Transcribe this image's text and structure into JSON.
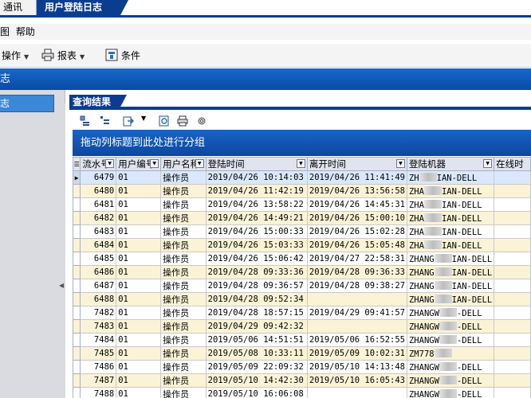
{
  "tabs": {
    "prev_label": "通讯",
    "active_label": "用户登陆日志"
  },
  "menu": {
    "items": [
      "图",
      "帮助"
    ]
  },
  "toolbar": {
    "operate_label": "操作",
    "report_label": "报表",
    "condition_label": "条件"
  },
  "title_band": {
    "text": "志"
  },
  "nav": {
    "item_label": "志"
  },
  "result": {
    "tab_label": "查询结果",
    "group_hint": "拖动列标题到此处进行分组"
  },
  "grid": {
    "columns": [
      "流水号",
      "用户编号",
      "用户名称",
      "登陆时间",
      "离开时间",
      "登陆机器",
      "在线时"
    ],
    "rows": [
      {
        "id": "6479",
        "user_no": "01",
        "user_name": "操作员",
        "login": "2019/04/26 10:14:03",
        "logout": "2019/04/26 11:41:49",
        "machine_a": "ZH",
        "machine_b": "IAN-DELL"
      },
      {
        "id": "6480",
        "user_no": "01",
        "user_name": "操作员",
        "login": "2019/04/26 11:42:19",
        "logout": "2019/04/26 13:56:58",
        "machine_a": "ZHA",
        "machine_b": "IAN-DELL"
      },
      {
        "id": "6481",
        "user_no": "01",
        "user_name": "操作员",
        "login": "2019/04/26 13:58:22",
        "logout": "2019/04/26 14:45:31",
        "machine_a": "ZHA",
        "machine_b": "IAN-DELL"
      },
      {
        "id": "6482",
        "user_no": "01",
        "user_name": "操作员",
        "login": "2019/04/26 14:49:21",
        "logout": "2019/04/26 15:00:10",
        "machine_a": "ZHA",
        "machine_b": "IAN-DELL"
      },
      {
        "id": "6483",
        "user_no": "01",
        "user_name": "操作员",
        "login": "2019/04/26 15:00:33",
        "logout": "2019/04/26 15:02:28",
        "machine_a": "ZHA",
        "machine_b": "IAN-DELL"
      },
      {
        "id": "6484",
        "user_no": "01",
        "user_name": "操作员",
        "login": "2019/04/26 15:03:33",
        "logout": "2019/04/26 15:05:48",
        "machine_a": "ZHA",
        "machine_b": "IAN-DELL"
      },
      {
        "id": "6485",
        "user_no": "01",
        "user_name": "操作员",
        "login": "2019/04/26 15:06:42",
        "logout": "2019/04/27 22:58:31",
        "machine_a": "ZHANG",
        "machine_b": "IAN-DELL"
      },
      {
        "id": "6486",
        "user_no": "01",
        "user_name": "操作员",
        "login": "2019/04/28 09:33:36",
        "logout": "2019/04/28 09:36:33",
        "machine_a": "ZHANG",
        "machine_b": "IAN-DELL"
      },
      {
        "id": "6487",
        "user_no": "01",
        "user_name": "操作员",
        "login": "2019/04/28 09:36:57",
        "logout": "2019/04/28 09:38:27",
        "machine_a": "ZHANG",
        "machine_b": "IAN-DELL"
      },
      {
        "id": "6488",
        "user_no": "01",
        "user_name": "操作员",
        "login": "2019/04/28 09:52:34",
        "logout": "",
        "machine_a": "ZHANG",
        "machine_b": "IAN-DELL"
      },
      {
        "id": "7482",
        "user_no": "01",
        "user_name": "操作员",
        "login": "2019/04/28 18:57:15",
        "logout": "2019/04/29 09:41:57",
        "machine_a": "ZHANGW",
        "machine_b": "-DELL"
      },
      {
        "id": "7483",
        "user_no": "01",
        "user_name": "操作员",
        "login": "2019/04/29 09:42:32",
        "logout": "",
        "machine_a": "ZHANGW",
        "machine_b": "-DELL"
      },
      {
        "id": "7484",
        "user_no": "01",
        "user_name": "操作员",
        "login": "2019/05/06 14:51:51",
        "logout": "2019/05/06 16:52:55",
        "machine_a": "ZHANGW",
        "machine_b": "-DELL"
      },
      {
        "id": "7485",
        "user_no": "01",
        "user_name": "操作员",
        "login": "2019/05/08 10:33:11",
        "logout": "2019/05/09 10:02:31",
        "machine_a": "ZM778",
        "machine_b": ""
      },
      {
        "id": "7486",
        "user_no": "01",
        "user_name": "操作员",
        "login": "2019/05/09 22:09:32",
        "logout": "2019/05/10 14:13:48",
        "machine_a": "ZHANGW",
        "machine_b": "-DELL"
      },
      {
        "id": "7487",
        "user_no": "01",
        "user_name": "操作员",
        "login": "2019/05/10 14:42:30",
        "logout": "2019/05/10 16:05:43",
        "machine_a": "ZHANGW",
        "machine_b": "-DELL"
      },
      {
        "id": "7488",
        "user_no": "01",
        "user_name": "操作员",
        "login": "2019/05/10 16:06:08",
        "logout": "",
        "machine_a": "ZHANGW",
        "machine_b": "-DELL"
      }
    ]
  },
  "icons": {
    "operate": "operate-icon",
    "report": "printer-icon",
    "condition": "filter-icon"
  },
  "colors": {
    "accent": "#0a3d8f",
    "band": "#1769c9",
    "row_alt": "#fbf3d5",
    "row_selected": "#d9e8ff"
  }
}
